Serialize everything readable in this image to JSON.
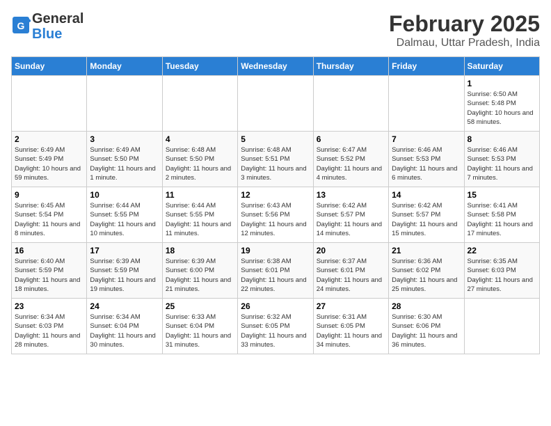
{
  "header": {
    "logo_general": "General",
    "logo_blue": "Blue",
    "month": "February 2025",
    "location": "Dalmau, Uttar Pradesh, India"
  },
  "days_of_week": [
    "Sunday",
    "Monday",
    "Tuesday",
    "Wednesday",
    "Thursday",
    "Friday",
    "Saturday"
  ],
  "weeks": [
    [
      {
        "day": "",
        "info": ""
      },
      {
        "day": "",
        "info": ""
      },
      {
        "day": "",
        "info": ""
      },
      {
        "day": "",
        "info": ""
      },
      {
        "day": "",
        "info": ""
      },
      {
        "day": "",
        "info": ""
      },
      {
        "day": "1",
        "info": "Sunrise: 6:50 AM\nSunset: 5:48 PM\nDaylight: 10 hours and 58 minutes."
      }
    ],
    [
      {
        "day": "2",
        "info": "Sunrise: 6:49 AM\nSunset: 5:49 PM\nDaylight: 10 hours and 59 minutes."
      },
      {
        "day": "3",
        "info": "Sunrise: 6:49 AM\nSunset: 5:50 PM\nDaylight: 11 hours and 1 minute."
      },
      {
        "day": "4",
        "info": "Sunrise: 6:48 AM\nSunset: 5:50 PM\nDaylight: 11 hours and 2 minutes."
      },
      {
        "day": "5",
        "info": "Sunrise: 6:48 AM\nSunset: 5:51 PM\nDaylight: 11 hours and 3 minutes."
      },
      {
        "day": "6",
        "info": "Sunrise: 6:47 AM\nSunset: 5:52 PM\nDaylight: 11 hours and 4 minutes."
      },
      {
        "day": "7",
        "info": "Sunrise: 6:46 AM\nSunset: 5:53 PM\nDaylight: 11 hours and 6 minutes."
      },
      {
        "day": "8",
        "info": "Sunrise: 6:46 AM\nSunset: 5:53 PM\nDaylight: 11 hours and 7 minutes."
      }
    ],
    [
      {
        "day": "9",
        "info": "Sunrise: 6:45 AM\nSunset: 5:54 PM\nDaylight: 11 hours and 8 minutes."
      },
      {
        "day": "10",
        "info": "Sunrise: 6:44 AM\nSunset: 5:55 PM\nDaylight: 11 hours and 10 minutes."
      },
      {
        "day": "11",
        "info": "Sunrise: 6:44 AM\nSunset: 5:55 PM\nDaylight: 11 hours and 11 minutes."
      },
      {
        "day": "12",
        "info": "Sunrise: 6:43 AM\nSunset: 5:56 PM\nDaylight: 11 hours and 12 minutes."
      },
      {
        "day": "13",
        "info": "Sunrise: 6:42 AM\nSunset: 5:57 PM\nDaylight: 11 hours and 14 minutes."
      },
      {
        "day": "14",
        "info": "Sunrise: 6:42 AM\nSunset: 5:57 PM\nDaylight: 11 hours and 15 minutes."
      },
      {
        "day": "15",
        "info": "Sunrise: 6:41 AM\nSunset: 5:58 PM\nDaylight: 11 hours and 17 minutes."
      }
    ],
    [
      {
        "day": "16",
        "info": "Sunrise: 6:40 AM\nSunset: 5:59 PM\nDaylight: 11 hours and 18 minutes."
      },
      {
        "day": "17",
        "info": "Sunrise: 6:39 AM\nSunset: 5:59 PM\nDaylight: 11 hours and 19 minutes."
      },
      {
        "day": "18",
        "info": "Sunrise: 6:39 AM\nSunset: 6:00 PM\nDaylight: 11 hours and 21 minutes."
      },
      {
        "day": "19",
        "info": "Sunrise: 6:38 AM\nSunset: 6:01 PM\nDaylight: 11 hours and 22 minutes."
      },
      {
        "day": "20",
        "info": "Sunrise: 6:37 AM\nSunset: 6:01 PM\nDaylight: 11 hours and 24 minutes."
      },
      {
        "day": "21",
        "info": "Sunrise: 6:36 AM\nSunset: 6:02 PM\nDaylight: 11 hours and 25 minutes."
      },
      {
        "day": "22",
        "info": "Sunrise: 6:35 AM\nSunset: 6:03 PM\nDaylight: 11 hours and 27 minutes."
      }
    ],
    [
      {
        "day": "23",
        "info": "Sunrise: 6:34 AM\nSunset: 6:03 PM\nDaylight: 11 hours and 28 minutes."
      },
      {
        "day": "24",
        "info": "Sunrise: 6:34 AM\nSunset: 6:04 PM\nDaylight: 11 hours and 30 minutes."
      },
      {
        "day": "25",
        "info": "Sunrise: 6:33 AM\nSunset: 6:04 PM\nDaylight: 11 hours and 31 minutes."
      },
      {
        "day": "26",
        "info": "Sunrise: 6:32 AM\nSunset: 6:05 PM\nDaylight: 11 hours and 33 minutes."
      },
      {
        "day": "27",
        "info": "Sunrise: 6:31 AM\nSunset: 6:05 PM\nDaylight: 11 hours and 34 minutes."
      },
      {
        "day": "28",
        "info": "Sunrise: 6:30 AM\nSunset: 6:06 PM\nDaylight: 11 hours and 36 minutes."
      },
      {
        "day": "",
        "info": ""
      }
    ]
  ]
}
